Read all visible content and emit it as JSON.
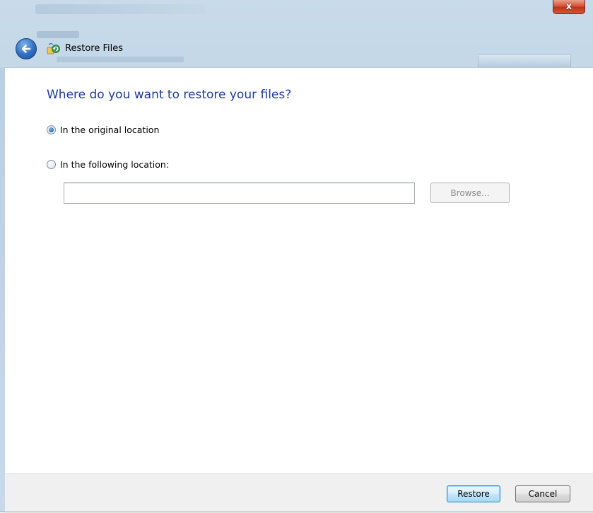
{
  "window": {
    "title": "Restore Files",
    "close_glyph": "x"
  },
  "main": {
    "heading": "Where do you want to restore your files?",
    "options": [
      {
        "label": "In the original location",
        "selected": true
      },
      {
        "label": "In the following location:",
        "selected": false
      }
    ],
    "location_input": {
      "value": "",
      "placeholder": ""
    },
    "browse_label": "Browse...",
    "browse_enabled": false
  },
  "footer": {
    "restore_label": "Restore",
    "cancel_label": "Cancel"
  },
  "icons": {
    "back": "back-arrow-icon",
    "title": "restore-files-icon",
    "close": "close-icon"
  },
  "colors": {
    "heading": "#1e3a9e",
    "frame": "#b7cfe4",
    "close": "#c2321b"
  }
}
